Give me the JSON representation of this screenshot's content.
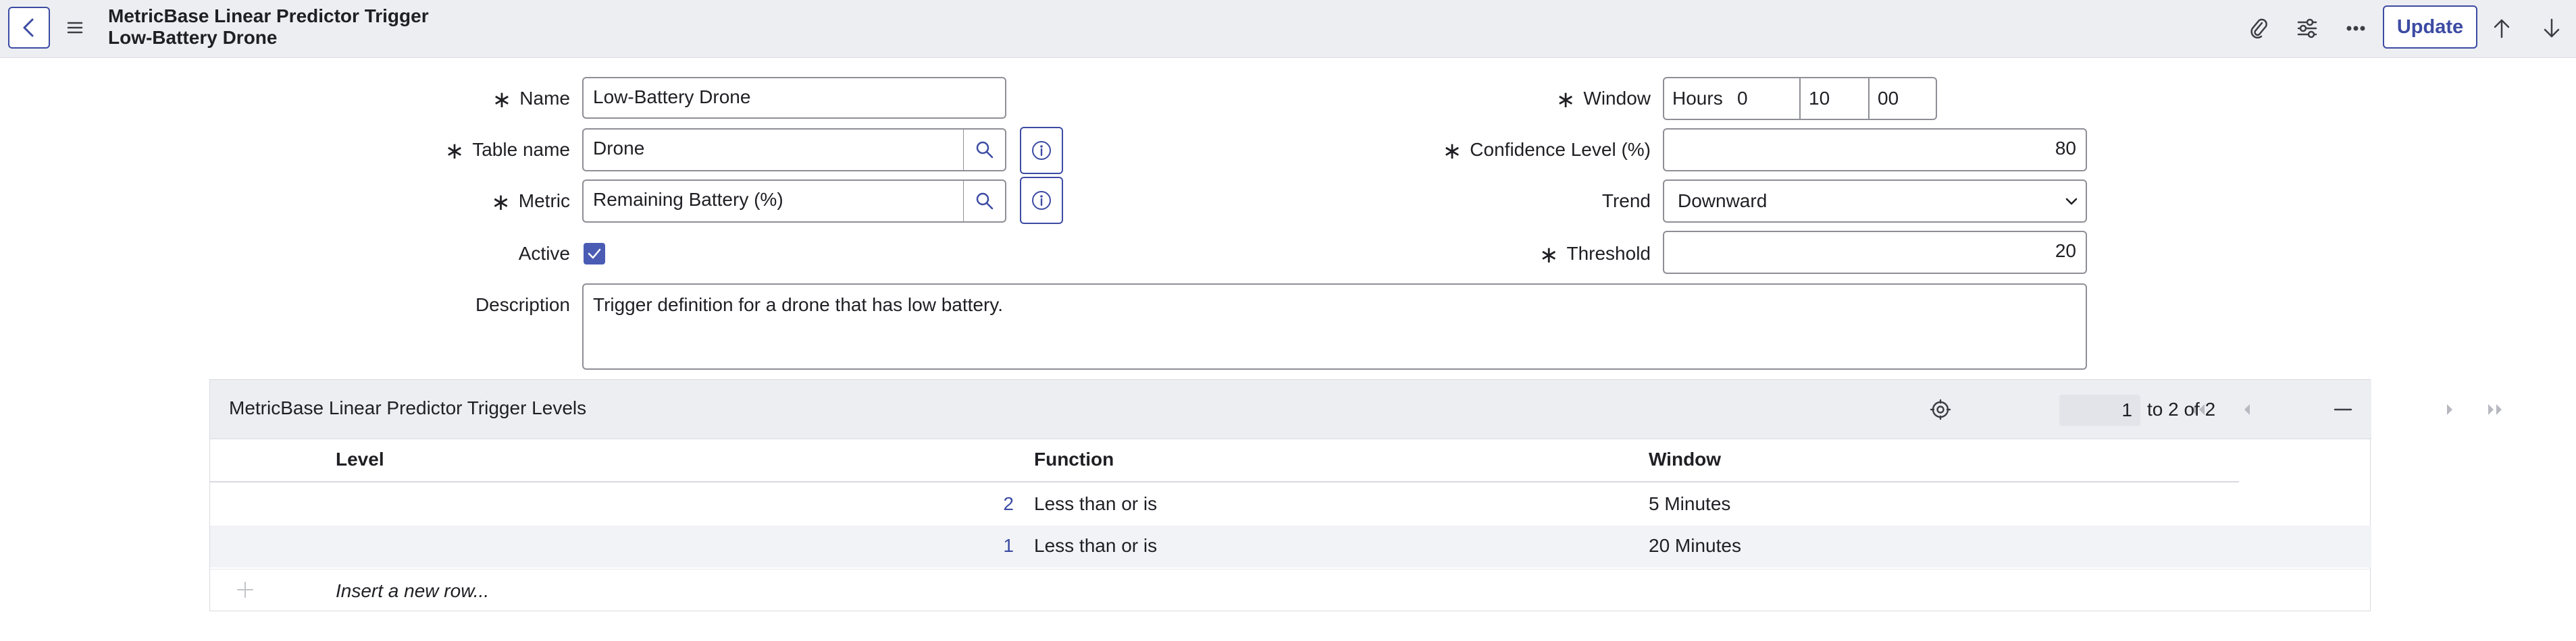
{
  "header": {
    "title_line1": "MetricBase Linear Predictor Trigger",
    "title_line2": "Low-Battery Drone",
    "update_label": "Update"
  },
  "form": {
    "name": {
      "label": "Name",
      "value": "Low-Battery Drone",
      "required": true
    },
    "table_name": {
      "label": "Table name",
      "value": "Drone",
      "required": true
    },
    "metric": {
      "label": "Metric",
      "value": "Remaining Battery (%)",
      "required": true
    },
    "active": {
      "label": "Active",
      "checked": true
    },
    "description": {
      "label": "Description",
      "value": "Trigger definition for a drone that has low battery."
    },
    "window": {
      "label": "Window",
      "unit": "Hours",
      "hours": "0",
      "minutes": "10",
      "seconds": "00",
      "required": true
    },
    "confidence_level": {
      "label": "Confidence Level (%)",
      "value": "80",
      "required": true
    },
    "trend": {
      "label": "Trend",
      "value": "Downward"
    },
    "threshold": {
      "label": "Threshold",
      "value": "20",
      "required": true
    }
  },
  "related_list": {
    "title": "MetricBase Linear Predictor Trigger Levels",
    "pagination": {
      "current": "1",
      "text": "to 2 of 2"
    },
    "columns": [
      "Level",
      "Function",
      "Window"
    ],
    "rows": [
      {
        "level": "2",
        "function": "Less than or is",
        "window": "5 Minutes"
      },
      {
        "level": "1",
        "function": "Less than or is",
        "window": "20 Minutes"
      }
    ],
    "insert_label": "Insert a new row..."
  },
  "colors": {
    "accent": "#3c4ba3",
    "header_bg": "#edeef2",
    "checkbox": "#4a5bb4"
  }
}
